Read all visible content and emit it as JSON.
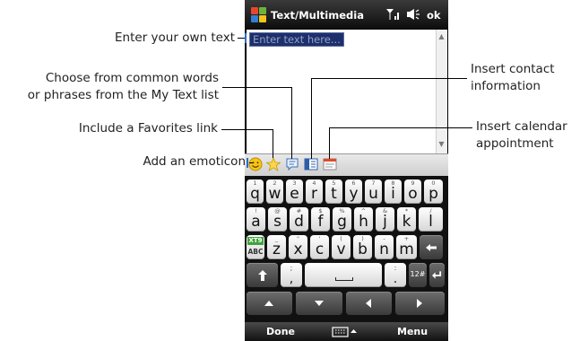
{
  "phone": {
    "title": "Text/Multimedia",
    "ok_label": "ok",
    "placeholder": "Enter text here...",
    "softkeys": {
      "left": "Done",
      "right": "Menu"
    }
  },
  "callouts": {
    "enter_text": "Enter your own text",
    "my_text_line1": "Choose from common words",
    "my_text_line2": "or phrases from the My Text list",
    "favorites": "Include a Favorites link",
    "emoticon": "Add an emoticon",
    "contact_line1": "Insert contact",
    "contact_line2": "information",
    "calendar_line1": "Insert calendar",
    "calendar_line2": "appointment"
  },
  "toolbar_icons": [
    "emoticon-icon",
    "favorites-star-icon",
    "my-text-icon",
    "contact-card-icon",
    "calendar-icon"
  ],
  "keyboard": {
    "row1": [
      {
        "k": "q",
        "a": "1"
      },
      {
        "k": "w",
        "a": "2"
      },
      {
        "k": "e",
        "a": "3"
      },
      {
        "k": "r",
        "a": "4"
      },
      {
        "k": "t",
        "a": "5"
      },
      {
        "k": "y",
        "a": "6"
      },
      {
        "k": "u",
        "a": "7"
      },
      {
        "k": "i",
        "a": "8"
      },
      {
        "k": "o",
        "a": "9"
      },
      {
        "k": "p",
        "a": "0"
      }
    ],
    "row2": [
      {
        "k": "a",
        "a": "!"
      },
      {
        "k": "s",
        "a": "@"
      },
      {
        "k": "d",
        "a": "#"
      },
      {
        "k": "f",
        "a": "$"
      },
      {
        "k": "g",
        "a": "%"
      },
      {
        "k": "h",
        "a": "^"
      },
      {
        "k": "j",
        "a": "&"
      },
      {
        "k": "k",
        "a": "*"
      },
      {
        "k": "l",
        "a": "/"
      }
    ],
    "row3": [
      {
        "k": "z",
        "a": "_"
      },
      {
        "k": "x",
        "a": "\""
      },
      {
        "k": "c",
        "a": "'"
      },
      {
        "k": "v",
        "a": "("
      },
      {
        "k": "b",
        "a": ")"
      },
      {
        "k": "n",
        "a": "-"
      },
      {
        "k": "m",
        "a": "+"
      }
    ],
    "mode_key_top": "XT9",
    "mode_key_bottom": "ABC",
    "comma": ",",
    "semicolon": ";",
    "period": ".",
    "colon": ":",
    "symbols": "12#"
  },
  "colors": {
    "callout_line": "#000000",
    "callout_endpoint": "#2a6fc4",
    "placeholder_bg": "#1f2f6b"
  }
}
